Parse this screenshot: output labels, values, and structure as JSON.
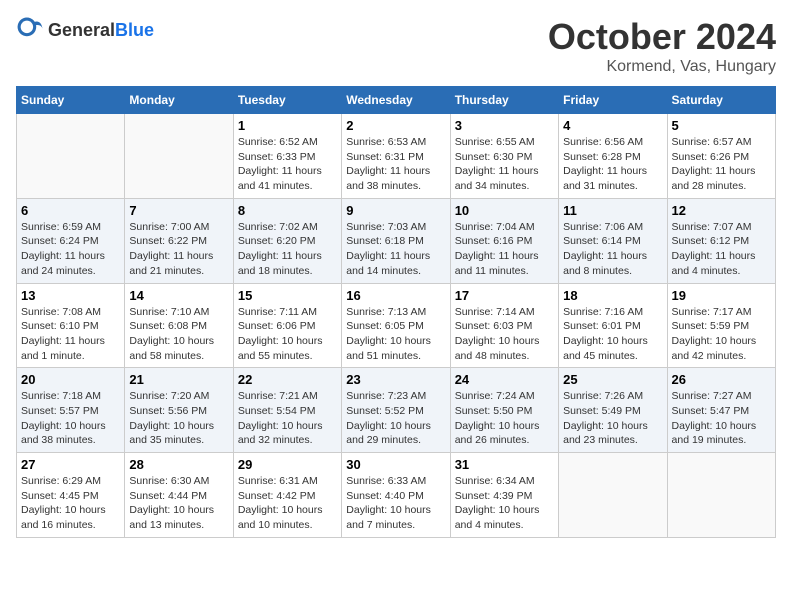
{
  "header": {
    "logo_general": "General",
    "logo_blue": "Blue",
    "month": "October 2024",
    "location": "Kormend, Vas, Hungary"
  },
  "weekdays": [
    "Sunday",
    "Monday",
    "Tuesday",
    "Wednesday",
    "Thursday",
    "Friday",
    "Saturday"
  ],
  "weeks": [
    [
      {
        "day": "",
        "info": ""
      },
      {
        "day": "",
        "info": ""
      },
      {
        "day": "1",
        "info": "Sunrise: 6:52 AM\nSunset: 6:33 PM\nDaylight: 11 hours and 41 minutes."
      },
      {
        "day": "2",
        "info": "Sunrise: 6:53 AM\nSunset: 6:31 PM\nDaylight: 11 hours and 38 minutes."
      },
      {
        "day": "3",
        "info": "Sunrise: 6:55 AM\nSunset: 6:30 PM\nDaylight: 11 hours and 34 minutes."
      },
      {
        "day": "4",
        "info": "Sunrise: 6:56 AM\nSunset: 6:28 PM\nDaylight: 11 hours and 31 minutes."
      },
      {
        "day": "5",
        "info": "Sunrise: 6:57 AM\nSunset: 6:26 PM\nDaylight: 11 hours and 28 minutes."
      }
    ],
    [
      {
        "day": "6",
        "info": "Sunrise: 6:59 AM\nSunset: 6:24 PM\nDaylight: 11 hours and 24 minutes."
      },
      {
        "day": "7",
        "info": "Sunrise: 7:00 AM\nSunset: 6:22 PM\nDaylight: 11 hours and 21 minutes."
      },
      {
        "day": "8",
        "info": "Sunrise: 7:02 AM\nSunset: 6:20 PM\nDaylight: 11 hours and 18 minutes."
      },
      {
        "day": "9",
        "info": "Sunrise: 7:03 AM\nSunset: 6:18 PM\nDaylight: 11 hours and 14 minutes."
      },
      {
        "day": "10",
        "info": "Sunrise: 7:04 AM\nSunset: 6:16 PM\nDaylight: 11 hours and 11 minutes."
      },
      {
        "day": "11",
        "info": "Sunrise: 7:06 AM\nSunset: 6:14 PM\nDaylight: 11 hours and 8 minutes."
      },
      {
        "day": "12",
        "info": "Sunrise: 7:07 AM\nSunset: 6:12 PM\nDaylight: 11 hours and 4 minutes."
      }
    ],
    [
      {
        "day": "13",
        "info": "Sunrise: 7:08 AM\nSunset: 6:10 PM\nDaylight: 11 hours and 1 minute."
      },
      {
        "day": "14",
        "info": "Sunrise: 7:10 AM\nSunset: 6:08 PM\nDaylight: 10 hours and 58 minutes."
      },
      {
        "day": "15",
        "info": "Sunrise: 7:11 AM\nSunset: 6:06 PM\nDaylight: 10 hours and 55 minutes."
      },
      {
        "day": "16",
        "info": "Sunrise: 7:13 AM\nSunset: 6:05 PM\nDaylight: 10 hours and 51 minutes."
      },
      {
        "day": "17",
        "info": "Sunrise: 7:14 AM\nSunset: 6:03 PM\nDaylight: 10 hours and 48 minutes."
      },
      {
        "day": "18",
        "info": "Sunrise: 7:16 AM\nSunset: 6:01 PM\nDaylight: 10 hours and 45 minutes."
      },
      {
        "day": "19",
        "info": "Sunrise: 7:17 AM\nSunset: 5:59 PM\nDaylight: 10 hours and 42 minutes."
      }
    ],
    [
      {
        "day": "20",
        "info": "Sunrise: 7:18 AM\nSunset: 5:57 PM\nDaylight: 10 hours and 38 minutes."
      },
      {
        "day": "21",
        "info": "Sunrise: 7:20 AM\nSunset: 5:56 PM\nDaylight: 10 hours and 35 minutes."
      },
      {
        "day": "22",
        "info": "Sunrise: 7:21 AM\nSunset: 5:54 PM\nDaylight: 10 hours and 32 minutes."
      },
      {
        "day": "23",
        "info": "Sunrise: 7:23 AM\nSunset: 5:52 PM\nDaylight: 10 hours and 29 minutes."
      },
      {
        "day": "24",
        "info": "Sunrise: 7:24 AM\nSunset: 5:50 PM\nDaylight: 10 hours and 26 minutes."
      },
      {
        "day": "25",
        "info": "Sunrise: 7:26 AM\nSunset: 5:49 PM\nDaylight: 10 hours and 23 minutes."
      },
      {
        "day": "26",
        "info": "Sunrise: 7:27 AM\nSunset: 5:47 PM\nDaylight: 10 hours and 19 minutes."
      }
    ],
    [
      {
        "day": "27",
        "info": "Sunrise: 6:29 AM\nSunset: 4:45 PM\nDaylight: 10 hours and 16 minutes."
      },
      {
        "day": "28",
        "info": "Sunrise: 6:30 AM\nSunset: 4:44 PM\nDaylight: 10 hours and 13 minutes."
      },
      {
        "day": "29",
        "info": "Sunrise: 6:31 AM\nSunset: 4:42 PM\nDaylight: 10 hours and 10 minutes."
      },
      {
        "day": "30",
        "info": "Sunrise: 6:33 AM\nSunset: 4:40 PM\nDaylight: 10 hours and 7 minutes."
      },
      {
        "day": "31",
        "info": "Sunrise: 6:34 AM\nSunset: 4:39 PM\nDaylight: 10 hours and 4 minutes."
      },
      {
        "day": "",
        "info": ""
      },
      {
        "day": "",
        "info": ""
      }
    ]
  ]
}
